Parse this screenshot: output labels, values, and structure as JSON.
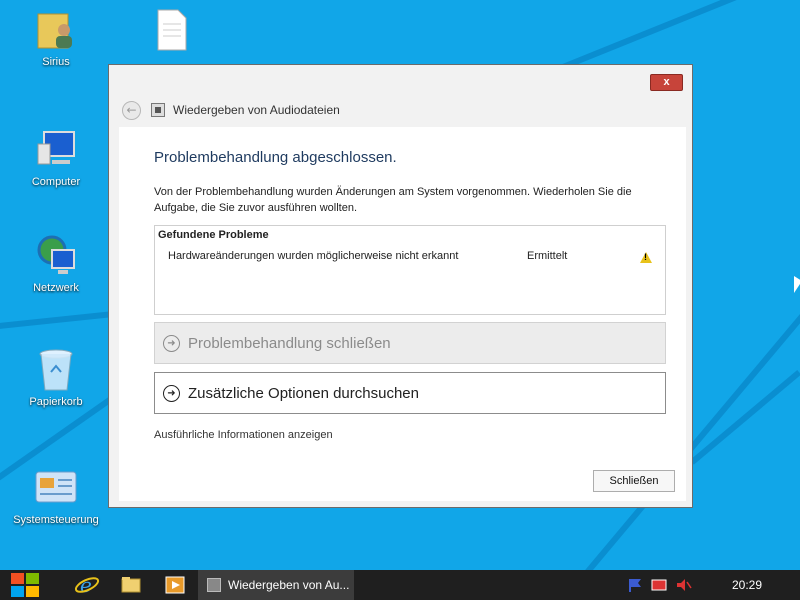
{
  "desktop": {
    "icons": [
      {
        "label": "Sirius",
        "icon": "user-folder-icon"
      },
      {
        "label": "",
        "icon": "document-icon"
      },
      {
        "label": "Computer",
        "icon": "computer-icon"
      },
      {
        "label": "Netzwerk",
        "icon": "network-icon"
      },
      {
        "label": "Papierkorb",
        "icon": "recycle-bin-icon"
      },
      {
        "label": "Systemsteuerung",
        "icon": "control-panel-icon"
      }
    ],
    "background_color": "#11a6e8"
  },
  "window": {
    "close_label": "x",
    "nav_title": "Wiedergeben von Audiodateien",
    "heading": "Problembehandlung abgeschlossen.",
    "description": "Von der Problembehandlung wurden Änderungen am System vorgenommen. Wiederholen Sie die Aufgabe, die Sie zuvor ausführen wollten.",
    "problems_header": "Gefundene Probleme",
    "problems": [
      {
        "text": "Hardwareänderungen wurden möglicherweise nicht erkannt",
        "status": "Ermittelt",
        "icon": "warning-icon"
      }
    ],
    "commands": [
      {
        "label": "Problembehandlung schließen",
        "enabled": false
      },
      {
        "label": "Zusätzliche Optionen durchsuchen",
        "enabled": true
      }
    ],
    "details_link": "Ausführliche Informationen anzeigen",
    "close_button": "Schließen"
  },
  "taskbar": {
    "active_task": "Wiedergeben von Au...",
    "clock": "20:29",
    "pinned": [
      "internet-explorer-icon",
      "explorer-folder-icon",
      "media-player-icon"
    ],
    "tray": [
      "flag-icon",
      "network-tray-icon",
      "speaker-icon"
    ]
  }
}
